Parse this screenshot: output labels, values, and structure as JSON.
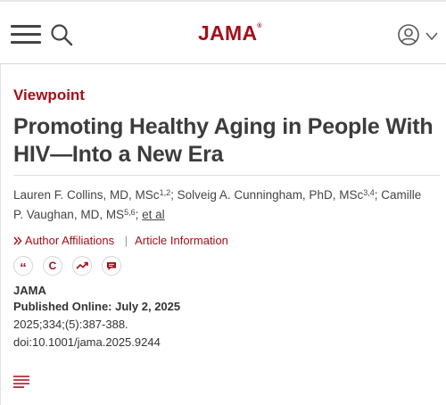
{
  "header": {
    "logo_text": "JAMA",
    "logo_mark": "®",
    "menu_icon": "hamburger-menu-icon",
    "search_icon": "search-icon",
    "user_icon": "user-account-icon",
    "caret_icon": "chevron-down-icon"
  },
  "article": {
    "type": "Viewpoint",
    "title": "Promoting Healthy Aging in People With HIV—Into a New Era",
    "authors": [
      {
        "name": "Lauren F. Collins, MD, MSc",
        "affil": "1,2",
        "sep": "; "
      },
      {
        "name": "Solveig A. Cunningham, PhD, MSc",
        "affil": "3,4",
        "sep": "; "
      },
      {
        "name": "Camille P. Vaughan, MD, MS",
        "affil": "5,6",
        "sep": "; "
      }
    ],
    "etal": "et al",
    "links": {
      "affiliations": "Author Affiliations",
      "info": "Article Information"
    },
    "journal": "JAMA",
    "published": "Published Online: July 2, 2025",
    "citation": "2025;334;(5):387-388.",
    "doi": "doi:10.1001/jama.2025.9244"
  },
  "tools": {
    "cite_glyph": "“",
    "cite_icon": "cite-icon",
    "permissions_glyph": "C",
    "permissions_icon": "permissions-icon",
    "metrics_icon": "metrics-trend-icon",
    "comment_icon": "comment-icon"
  },
  "colors": {
    "brand": "#a50f19",
    "text": "#333333",
    "border": "#d8d8d8"
  }
}
